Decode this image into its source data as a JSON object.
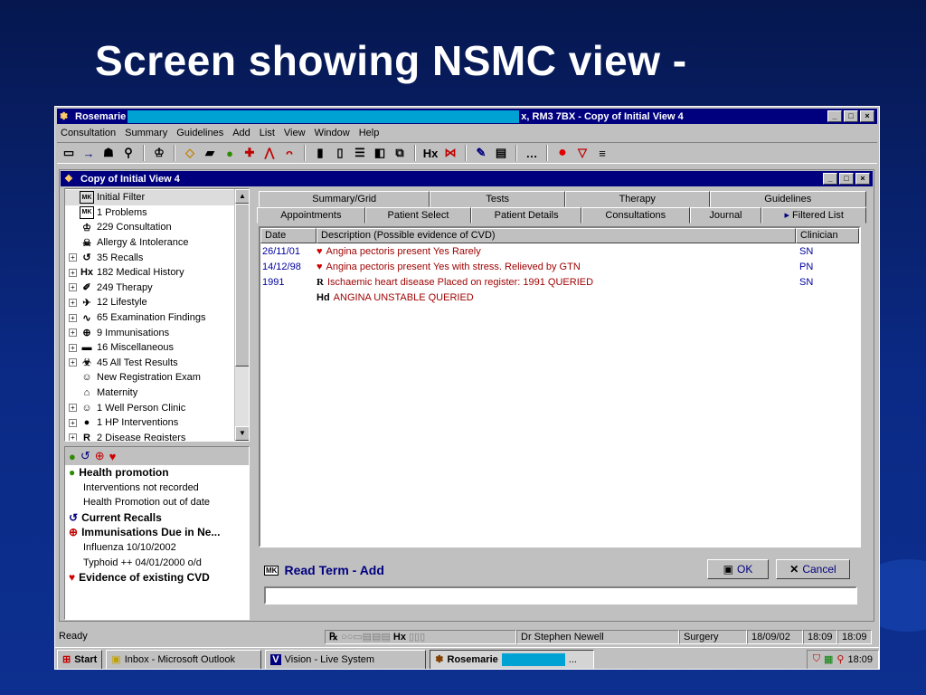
{
  "slide": {
    "title": "Screen showing NSMC view -"
  },
  "window": {
    "title_left": "Rosemarie",
    "title_right": "x, RM3 7BX - Copy of Initial View 4",
    "controls": [
      "_",
      "□",
      "×"
    ]
  },
  "menu": [
    "Consultation",
    "Summary",
    "Guidelines",
    "Add",
    "List",
    "View",
    "Window",
    "Help"
  ],
  "child_window": {
    "title": "Copy of Initial View 4"
  },
  "tree": [
    {
      "label": "Initial Filter",
      "icon": "mk-icon",
      "glyph": "MK",
      "exp": false
    },
    {
      "label": "1 Problems",
      "icon": "mk-icon",
      "glyph": "MK",
      "exp": false
    },
    {
      "label": "229 Consultation",
      "icon": "chair-icon",
      "glyph": "♔",
      "exp": false
    },
    {
      "label": "Allergy & Intolerance",
      "icon": "allergy-icon",
      "glyph": "☠",
      "exp": false
    },
    {
      "label": "35 Recalls",
      "icon": "recall-icon",
      "glyph": "↺",
      "exp": true
    },
    {
      "label": "182 Medical History",
      "icon": "hx-icon",
      "glyph": "Hx",
      "exp": true
    },
    {
      "label": "249 Therapy",
      "icon": "syringe-icon",
      "glyph": "✐",
      "exp": true
    },
    {
      "label": "12 Lifestyle",
      "icon": "lifestyle-icon",
      "glyph": "✈",
      "exp": true
    },
    {
      "label": "65 Examination Findings",
      "icon": "graph-icon",
      "glyph": "∿",
      "exp": true
    },
    {
      "label": "9 Immunisations",
      "icon": "immunisation-icon",
      "glyph": "⊕",
      "exp": true
    },
    {
      "label": "16 Miscellaneous",
      "icon": "folder-icon",
      "glyph": "▬",
      "exp": true
    },
    {
      "label": "45 All Test Results",
      "icon": "test-results-icon",
      "glyph": "☣",
      "exp": true
    },
    {
      "label": "New Registration Exam",
      "icon": "person-icon",
      "glyph": "☺",
      "exp": false
    },
    {
      "label": "Maternity",
      "icon": "pram-icon",
      "glyph": "⌂",
      "exp": false
    },
    {
      "label": "1 Well Person Clinic",
      "icon": "smiley-icon",
      "glyph": "☺",
      "exp": true
    },
    {
      "label": "1 HP Interventions",
      "icon": "apple-icon",
      "glyph": "●",
      "exp": true
    },
    {
      "label": "2 Disease Registers",
      "icon": "register-icon",
      "glyph": "R",
      "exp": true
    }
  ],
  "alerts": {
    "items": [
      {
        "type": "head",
        "label": "Health promotion",
        "icon": "apple-icon",
        "glyph": "●",
        "color": "#2e8b00"
      },
      {
        "type": "sub",
        "label": "Interventions not recorded"
      },
      {
        "type": "sub",
        "label": "Health Promotion out of date"
      },
      {
        "type": "head",
        "label": "Current Recalls",
        "icon": "recall-icon",
        "glyph": "↺",
        "color": "#00007f"
      },
      {
        "type": "head",
        "label": "Immunisations Due in Ne...",
        "icon": "immunisation-icon",
        "glyph": "⊕",
        "color": "#c00000"
      },
      {
        "type": "sub",
        "label": "Influenza  10/10/2002"
      },
      {
        "type": "sub",
        "label": "Typhoid ++ 04/01/2000  o/d"
      },
      {
        "type": "head",
        "label": "Evidence of existing CVD",
        "icon": "heart-icon",
        "glyph": "♥",
        "color": "#d00000"
      }
    ]
  },
  "tabs": {
    "row1": [
      "Summary/Grid",
      "Tests",
      "Therapy",
      "Guidelines"
    ],
    "row2": [
      "Appointments",
      "Patient Select",
      "Patient Details",
      "Consultations",
      "Journal",
      "Filtered List"
    ]
  },
  "grid": {
    "headers": [
      "Date",
      "Description (Possible evidence of CVD)",
      "Clinician"
    ],
    "rows": [
      {
        "date": "26/11/01",
        "icon": "heart-icon",
        "desc": "Angina pectoris  present  Yes   Rarely",
        "clinician": "SN"
      },
      {
        "date": "14/12/98",
        "icon": "heart-icon",
        "desc": "Angina pectoris  present  Yes   with stress. Relieved by GTN",
        "clinician": "PN"
      },
      {
        "date": "1991",
        "icon": "register-icon",
        "desc": "Ischaemic heart disease  Placed on register: 1991 QUERIED",
        "clinician": "SN"
      },
      {
        "date": "",
        "icon": "hd-icon",
        "desc": "ANGINA UNSTABLE QUERIED",
        "clinician": ""
      }
    ]
  },
  "readterm": {
    "label": "Read Term - Add",
    "ok": "OK",
    "cancel": "Cancel",
    "value": ""
  },
  "status": {
    "text": "Ready",
    "doctor": "Dr Stephen Newell",
    "location": "Surgery",
    "date": "18/09/02",
    "time1": "18:09",
    "time2": "18:09"
  },
  "taskbar": {
    "start": "Start",
    "inbox": "Inbox - Microsoft Outlook",
    "vision": "Vision - Live System",
    "rosemarie": "Rosemarie",
    "ellipsis": "...",
    "clock": "18:09"
  }
}
